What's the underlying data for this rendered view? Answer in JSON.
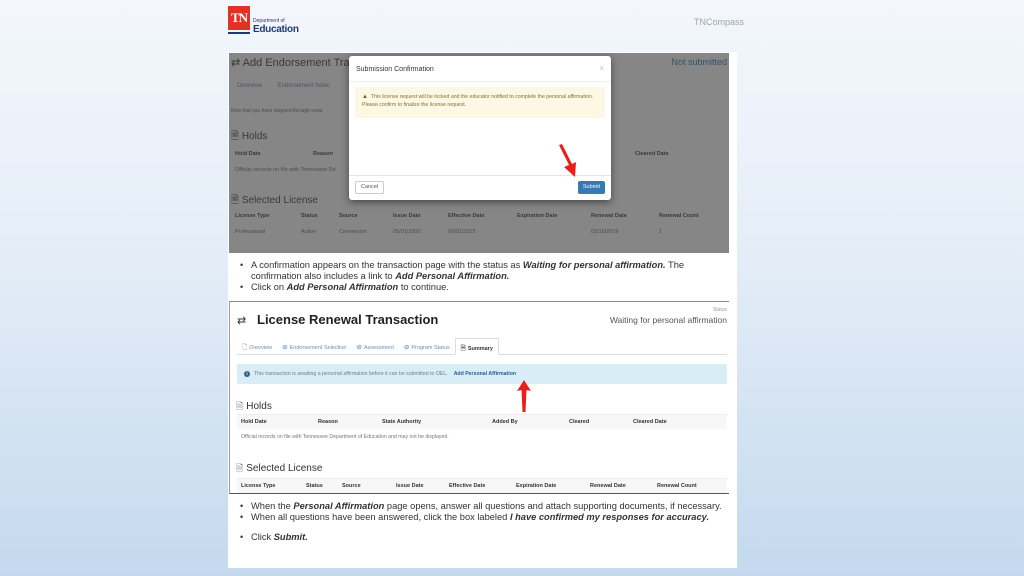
{
  "header": {
    "logo": {
      "mark": "TN",
      "line1": "Department of",
      "line2": "Education"
    },
    "brand": "TNCompass"
  },
  "screenshot1": {
    "background": {
      "title": "Add Endorsement Tra",
      "status": "Not submitted",
      "tabs": [
        "Overview",
        "Endorsement Selec"
      ],
      "intro": "Now that you have stepped through requi",
      "holds_heading": "Holds",
      "holds_columns": {
        "hold_date": "Hold Date",
        "reason": "Reason",
        "cleared_date": "Cleared Date"
      },
      "holds_note": "Official records on file with Tennessee De",
      "license_heading": "Selected License",
      "license_columns": [
        "License Type",
        "Status",
        "Source",
        "Issue Date",
        "Effective Date",
        "Expiration Date",
        "Renewal Date",
        "Renewal Count"
      ],
      "license_row": [
        "Professional",
        "Active",
        "Conversion",
        "05/01/2000",
        "09/01/2015",
        "",
        "03/16/2016",
        "1"
      ]
    },
    "modal": {
      "title": "Submission Confirmation",
      "close": "×",
      "warning_icon": "warning-triangle-icon",
      "warning_text": "This license request will be locked and the educator notified to complete the personal affirmation. Please confirm to finalize the license request.",
      "cancel_label": "Cancel",
      "submit_label": "Submit"
    }
  },
  "instructions1": {
    "items": [
      {
        "pre": "A confirmation appears on the transaction page with the status as ",
        "bold": "Waiting for personal affirmation.",
        "post": " The confirmation also includes a link to ",
        "bold2": "Add Personal Affirmation."
      },
      {
        "pre": "Click on ",
        "bold": "Add Personal Affirmation",
        "post": " to continue."
      }
    ]
  },
  "screenshot2": {
    "icon": "transfer-arrows-icon",
    "title": "License Renewal Transaction",
    "status_label": "Status",
    "status": "Waiting for personal affirmation",
    "tabs": [
      {
        "label": "Overview",
        "icon": "document-icon",
        "active": false
      },
      {
        "label": "Endorsement Selection",
        "icon": "check-circle-icon",
        "active": false
      },
      {
        "label": "Assessment",
        "icon": "check-circle-icon",
        "active": false
      },
      {
        "label": "Program Status",
        "icon": "check-circle-icon",
        "active": false
      },
      {
        "label": "Summary",
        "icon": "document-icon",
        "active": true
      }
    ],
    "info": {
      "text": "This transaction is awaiting a personal affirmation before it can be submitted to OEL.",
      "link": "Add Personal Affirmation"
    },
    "holds": {
      "heading": "Holds",
      "columns": [
        "Hold Date",
        "Reason",
        "State Authority",
        "Added By",
        "Cleared",
        "Cleared Date"
      ],
      "note": "Official records on file with Tennessee Department of Education and may not be displayed."
    },
    "license": {
      "heading": "Selected License",
      "columns": [
        "License Type",
        "Status",
        "Source",
        "Issue Date",
        "Effective Date",
        "Expiration Date",
        "Renewal Date",
        "Renewal Count"
      ]
    }
  },
  "instructions2": {
    "items": [
      {
        "pre": "When the ",
        "bold": "Personal Affirmation",
        "post": " page opens, answer all questions and attach supporting documents, if necessary."
      },
      {
        "pre": "When all questions have been answered, click the box labeled ",
        "bold": "I have confirmed my responses for accuracy.",
        "post": ""
      },
      {
        "pre": "Click ",
        "bold": "Submit.",
        "post": ""
      }
    ]
  },
  "colors": {
    "brand_red": "#e03326",
    "brand_navy": "#1f3a6e",
    "primary_button": "#337ab7",
    "warning_bg": "#fcf8e3",
    "info_bg": "#d9edf7",
    "arrow_red": "#e8201a"
  }
}
